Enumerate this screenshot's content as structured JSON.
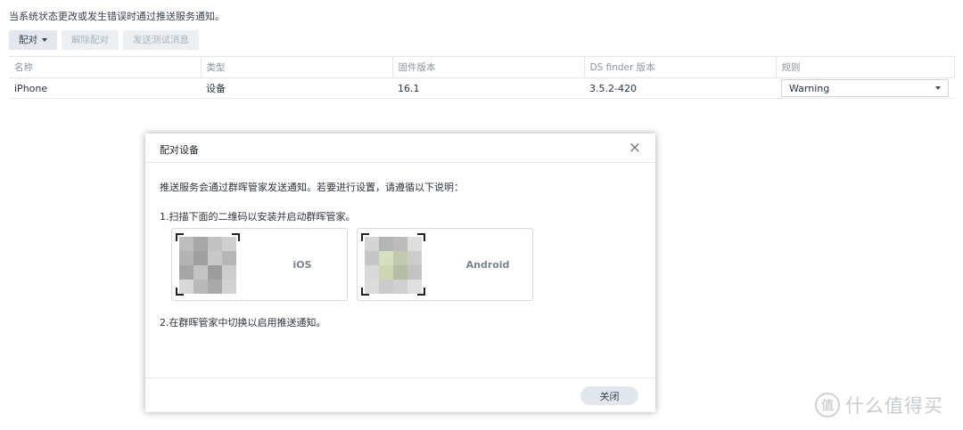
{
  "description": "当系统状态更改或发生错误时通过推送服务通知。",
  "toolbar": {
    "pair": "配对",
    "unpair": "解除配对",
    "send_test": "发送测试消息"
  },
  "table": {
    "columns": [
      "名称",
      "类型",
      "固件版本",
      "DS finder 版本",
      "规则"
    ],
    "rows": [
      {
        "name": "iPhone",
        "type": "设备",
        "firmware": "16.1",
        "ds_finder": "3.5.2-420",
        "rule": "Warning"
      }
    ]
  },
  "dialog": {
    "title": "配对设备",
    "close_glyph": "×",
    "intro": "推送服务会通过群晖管家发送通知。若要进行设置，请遵循以下说明：",
    "step1": "1.扫描下面的二维码以安装并启动群晖管家。",
    "step2": "2.在群晖管家中切换以启用推送通知。",
    "ios_label": "iOS",
    "android_label": "Android",
    "close_button": "关闭"
  },
  "watermark": {
    "icon_glyph": "值",
    "text": "什么值得买"
  },
  "icons": [
    "dropdown-caret-icon",
    "close-icon",
    "qr-code-ios",
    "qr-code-android",
    "smzdm-logo-icon"
  ],
  "colors": {
    "button_bg": "#e4e8ee",
    "disabled_text": "#a9b2bc",
    "dialog_button_bg": "#e2e7ee",
    "border": "#e3e6ea"
  }
}
